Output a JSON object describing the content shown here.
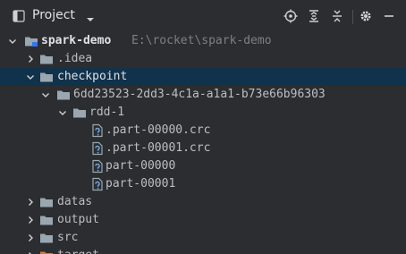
{
  "toolbar": {
    "view_label": "Project",
    "icons": [
      "locate-icon",
      "expand-all-icon",
      "collapse-all-icon",
      "settings-icon",
      "hide-icon"
    ]
  },
  "tree": {
    "root": {
      "name": "spark-demo",
      "path": "E:\\rocket\\spark-demo"
    },
    "items": [
      {
        "label": ".idea"
      },
      {
        "label": "checkpoint"
      },
      {
        "label": "6dd23523-2dd3-4c1a-a1a1-b73e66b96303"
      },
      {
        "label": "rdd-1"
      },
      {
        "label": ".part-00000.crc"
      },
      {
        "label": ".part-00001.crc"
      },
      {
        "label": "part-00000"
      },
      {
        "label": "part-00001"
      },
      {
        "label": "datas"
      },
      {
        "label": "output"
      },
      {
        "label": "src"
      },
      {
        "label": "target"
      }
    ]
  },
  "colors": {
    "background": "#2b2d30",
    "selection": "#11324b",
    "folder": "#9aa7b0",
    "target_folder": "#c77d42",
    "unknown_file": "#6f9fd8"
  }
}
